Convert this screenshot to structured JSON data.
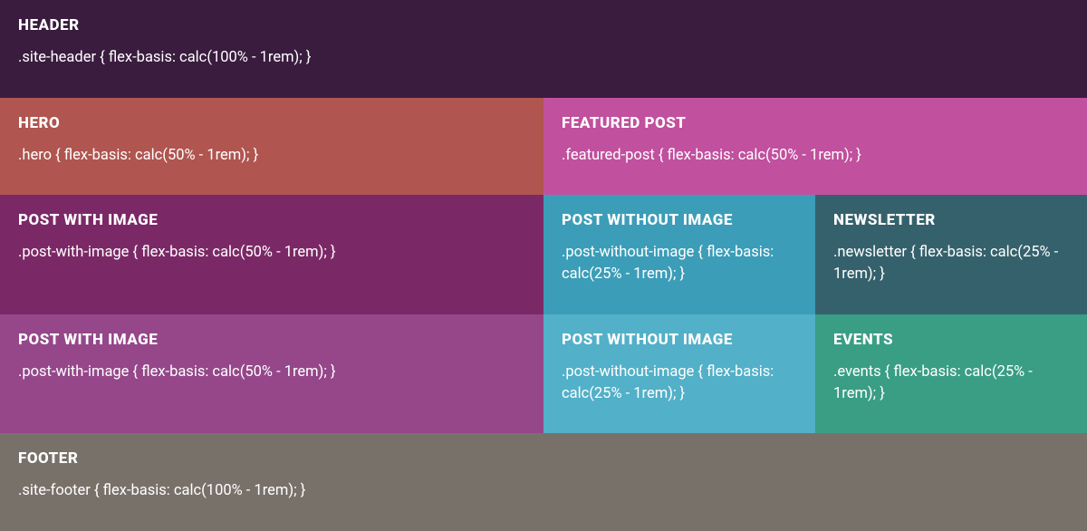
{
  "blocks": {
    "header": {
      "title": "HEADER",
      "code": ".site-header { flex-basis: calc(100% - 1rem); }"
    },
    "hero": {
      "title": "HERO",
      "code": ".hero { flex-basis: calc(50% - 1rem); }"
    },
    "featured": {
      "title": "FEATURED POST",
      "code": ".featured-post { flex-basis: calc(50% - 1rem); }"
    },
    "post_with_image_1": {
      "title": "POST WITH IMAGE",
      "code": ".post-with-image { flex-basis: calc(50% - 1rem); }"
    },
    "post_without_image_1": {
      "title": "POST WITHOUT IMAGE",
      "code": ".post-without-image { flex-basis: calc(25% - 1rem); }"
    },
    "newsletter": {
      "title": "NEWSLETTER",
      "code": ".newsletter { flex-basis: calc(25% - 1rem); }"
    },
    "post_with_image_2": {
      "title": "POST WITH IMAGE",
      "code": ".post-with-image { flex-basis: calc(50% - 1rem); }"
    },
    "post_without_image_2": {
      "title": "POST WITHOUT IMAGE",
      "code": ".post-without-image { flex-basis: calc(25% - 1rem); }"
    },
    "events": {
      "title": "EVENTS",
      "code": ".events { flex-basis: calc(25% - 1rem); }"
    },
    "footer": {
      "title": "FOOTER",
      "code": ".site-footer { flex-basis: calc(100% - 1rem); }"
    }
  }
}
